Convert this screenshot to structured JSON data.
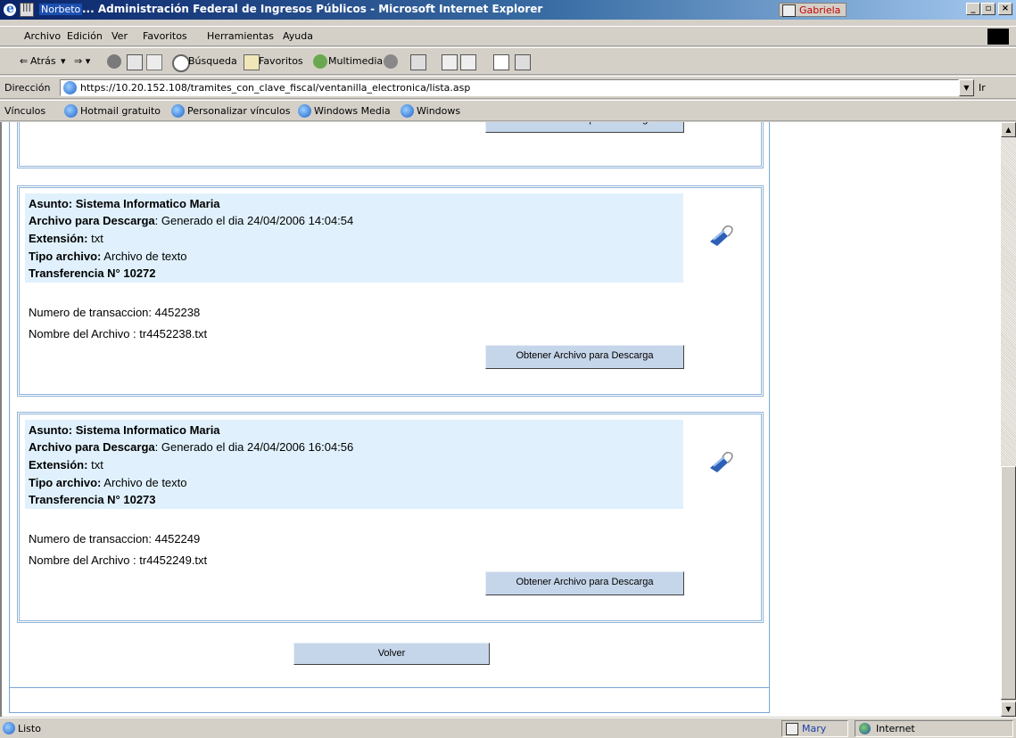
{
  "window": {
    "prefix": "Norbeto",
    "title": "... Administración Federal de Ingresos Públicos - Microsoft Internet Explorer",
    "task_label": "Gabriela",
    "min": "_",
    "max": "▫",
    "close": "×"
  },
  "menu": [
    "Archivo",
    "Edición",
    "Ver",
    "Favoritos",
    "Herramientas",
    "Ayuda"
  ],
  "toolbar": {
    "back": "Atrás",
    "search": "Búsqueda",
    "favorites": "Favoritos",
    "media": "Multimedia"
  },
  "address": {
    "label": "Dirección",
    "url": "https://10.20.152.108/tramites_con_clave_fiscal/ventanilla_electronica/lista.asp",
    "go": "Ir"
  },
  "links": {
    "label": "Vínculos",
    "items": [
      "Hotmail gratuito",
      "Personalizar vínculos",
      "Windows Media",
      "Windows"
    ]
  },
  "page": {
    "partial_button": "Obtener Archivo para Descarga",
    "cards": [
      {
        "asunto": "Asunto: Sistema Informatico Maria",
        "archivo_label": "Archivo para Descarga",
        "archivo_value": ": Generado el dia 24/04/2006 14:04:54",
        "ext_label": "Extensión:",
        "ext_value": " txt",
        "tipo_label": "Tipo archivo:",
        "tipo_value": " Archivo de texto",
        "transferencia": "Transferencia N° 10272",
        "transaccion": "Numero de transaccion: 4452238",
        "nombre": "Nombre del Archivo : tr4452238.txt",
        "button": "Obtener Archivo para Descarga"
      },
      {
        "asunto": "Asunto: Sistema Informatico Maria",
        "archivo_label": "Archivo para Descarga",
        "archivo_value": ": Generado el dia 24/04/2006 16:04:56",
        "ext_label": "Extensión:",
        "ext_value": " txt",
        "tipo_label": "Tipo archivo:",
        "tipo_value": " Archivo de texto",
        "transferencia": "Transferencia N° 10273",
        "transaccion": "Numero de transaccion: 4452249",
        "nombre": "Nombre del Archivo : tr4452249.txt",
        "button": "Obtener Archivo para Descarga"
      }
    ],
    "volver": "Volver"
  },
  "status": {
    "text": "Listo",
    "task": "Mary",
    "zone": "Internet"
  }
}
